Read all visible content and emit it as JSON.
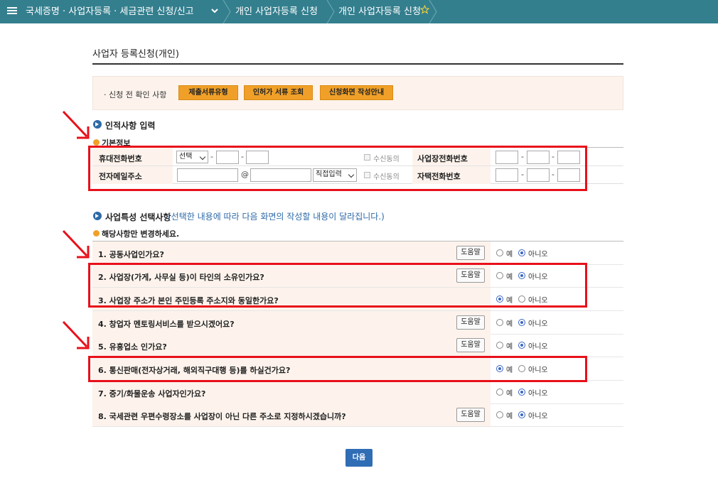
{
  "nav": {
    "crumb1": "국세증명 · 사업자등록 · 세금관련 신청/신고",
    "crumb2": "개인 사업자등록 신청",
    "crumb3": "개인 사업자등록 신청",
    "menu_icon": "hamburger-icon",
    "favorite_icon": "star-icon",
    "bar_color": "#347f8e"
  },
  "page_title": "사업자 등록신청(개인)",
  "pre_check": {
    "label": "· 신청 전 확인 사항",
    "buttons": [
      "제출서류유형",
      "인허가 서류 조회",
      "신청화면 작성안내"
    ]
  },
  "personal": {
    "section_title": "인적사항 입력",
    "sub_title": "기본정보",
    "mobile_label": "휴대전화번호",
    "mobile_select": "선택",
    "email_label": "전자메일주소",
    "email_at": "@",
    "email_domain_select": "직접입력",
    "consent_label": "수신동의",
    "biz_phone_label": "사업장전화번호",
    "home_phone_label": "자택전화번호",
    "dash": "-"
  },
  "biz": {
    "section_title": "사업특성 선택사항",
    "section_note": "(선택한 내용에 따라 다음 화면의 작성할 내용이 달라집니다.)",
    "sub_title": "해당사항만 변경하세요.",
    "help_label": "도움말",
    "yes_label": "예",
    "no_label": "아니오",
    "questions": [
      {
        "text": "1. 공동사업인가요?",
        "help": true,
        "answer": "no"
      },
      {
        "text": "2. 사업장(가게, 사무실 등)이 타인의 소유인가요?",
        "help": true,
        "answer": "no"
      },
      {
        "text": "3. 사업장 주소가 본인 주민등록 주소지와 동일한가요?",
        "help": false,
        "answer": "yes"
      },
      {
        "text": "4. 창업자 멘토링서비스를 받으시겠어요?",
        "help": true,
        "answer": "no"
      },
      {
        "text": "5. 유흥업소 인가요?",
        "help": true,
        "answer": "no"
      },
      {
        "text": "6. 통신판매(전자상거래, 해외직구대행 등)를 하실건가요?",
        "help": false,
        "answer": "yes"
      },
      {
        "text": "7. 중기/화물운송 사업자인가요?",
        "help": false,
        "answer": "no"
      },
      {
        "text": "8. 국세관련 우편수령장소를 사업장이 아닌 다른 주소로 지정하시겠습니까?",
        "help": true,
        "answer": "no"
      }
    ]
  },
  "next_label": "다음",
  "highlight_color": "#e8101a"
}
